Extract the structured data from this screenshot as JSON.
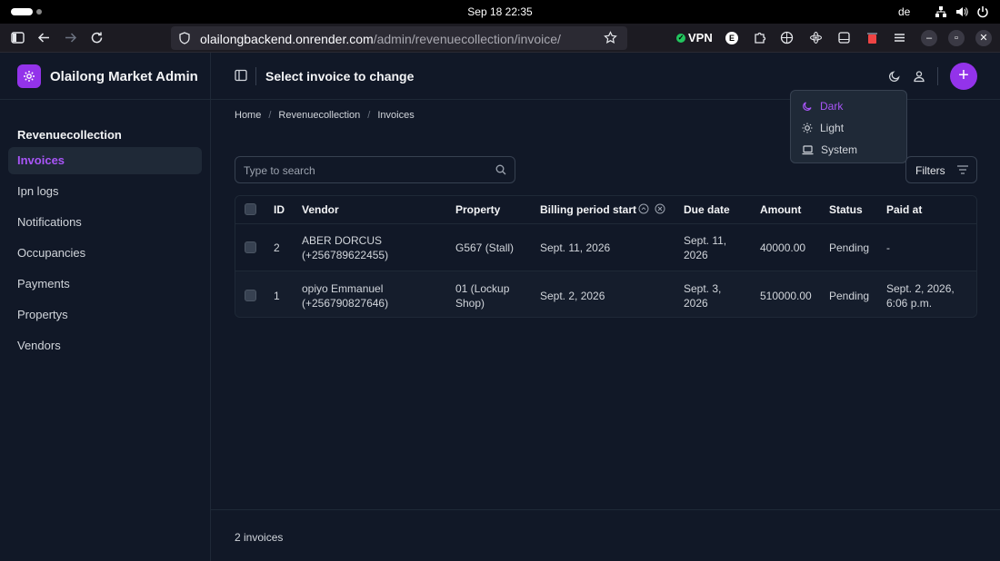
{
  "system": {
    "clock": "Sep 18  22:35",
    "lang": "de"
  },
  "browser": {
    "url_host": "olailongbackend.onrender.com",
    "url_path": "/admin/revenuecollection/invoice/",
    "vpn_label": "VPN",
    "ext_badge": "E"
  },
  "app": {
    "brand": "Olailong Market Admin",
    "page_title": "Select invoice to change",
    "add_label": "+",
    "accent": "#9333ea"
  },
  "sidebar": {
    "section": "Revenuecollection",
    "items": [
      {
        "label": "Invoices",
        "active": true
      },
      {
        "label": "Ipn logs"
      },
      {
        "label": "Notifications"
      },
      {
        "label": "Occupancies"
      },
      {
        "label": "Payments"
      },
      {
        "label": "Propertys"
      },
      {
        "label": "Vendors"
      }
    ]
  },
  "breadcrumb": {
    "home": "Home",
    "section": "Revenuecollection",
    "current": "Invoices",
    "sep": "/"
  },
  "search": {
    "placeholder": "Type to search",
    "value": ""
  },
  "filters_label": "Filters",
  "theme_menu": {
    "dark": "Dark",
    "light": "Light",
    "system": "System",
    "selected": "dark"
  },
  "table": {
    "columns": {
      "id": "ID",
      "vendor": "Vendor",
      "property": "Property",
      "billing": "Billing period start",
      "due": "Due date",
      "amount": "Amount",
      "status": "Status",
      "paid": "Paid at"
    },
    "rows": [
      {
        "id": "2",
        "vendor_name": "ABER DORCUS",
        "vendor_phone": "(+256789622455)",
        "property_l1": "G567 (Stall)",
        "property_l2": "",
        "billing": "Sept. 11, 2026",
        "due_l1": "Sept. 11,",
        "due_l2": "2026",
        "amount": "40000.00",
        "status": "Pending",
        "paid_l1": "-",
        "paid_l2": ""
      },
      {
        "id": "1",
        "vendor_name": "opiyo Emmanuel",
        "vendor_phone": "(+256790827646)",
        "property_l1": "01 (Lockup",
        "property_l2": "Shop)",
        "billing": "Sept. 2, 2026",
        "due_l1": "Sept. 3,",
        "due_l2": "2026",
        "amount": "510000.00",
        "status": "Pending",
        "paid_l1": "Sept. 2, 2026,",
        "paid_l2": "6:06 p.m."
      }
    ]
  },
  "footer": {
    "count": "2 invoices"
  }
}
